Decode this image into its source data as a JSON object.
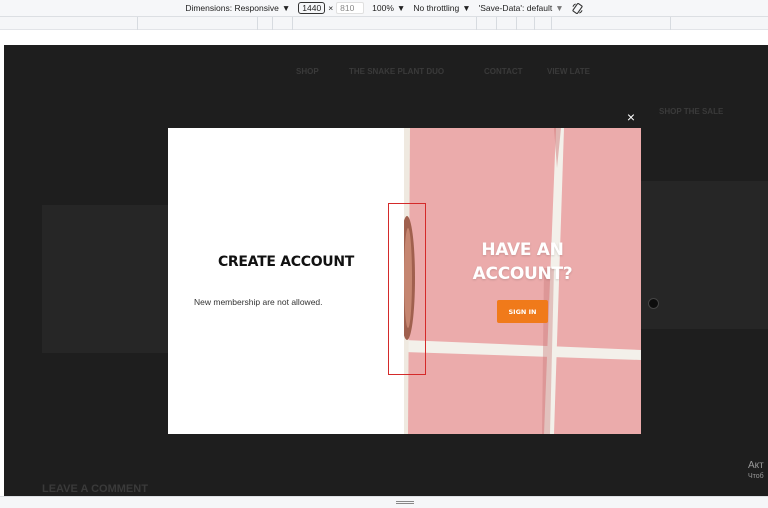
{
  "devtools": {
    "dimensions_label": "Dimensions: Responsive",
    "width_value": "1440",
    "times": "×",
    "height_value": "810",
    "zoom": "100%",
    "throttling": "No throttling",
    "save_data": "'Save-Data': default",
    "dropdown_glyph": "▼",
    "rotate_icon": "rotate-icon"
  },
  "background_site": {
    "nav_items": [
      "SHOP",
      "THE SNAKE PLANT DUO",
      "CONTACT",
      "VIEW LATE"
    ],
    "badge": "SHOP THE SALE",
    "section_heading": "LEAVE A COMMENT"
  },
  "modal": {
    "left_title": "CREATE ACCOUNT",
    "left_message": "New membership are not allowed.",
    "right_title_line1": "HAVE AN",
    "right_title_line2": "ACCOUNT?",
    "signin_label": "SIGN IN",
    "close_glyph": "×"
  },
  "watermark": {
    "line1": "Акт",
    "line2": "Чтоб"
  },
  "colors": {
    "accent": "#f07a1a",
    "overlay": "#1e1e1e",
    "highlight_box": "#d42a2a",
    "tile_pink": "#e8a3a4",
    "grout": "#f3f0ea"
  }
}
